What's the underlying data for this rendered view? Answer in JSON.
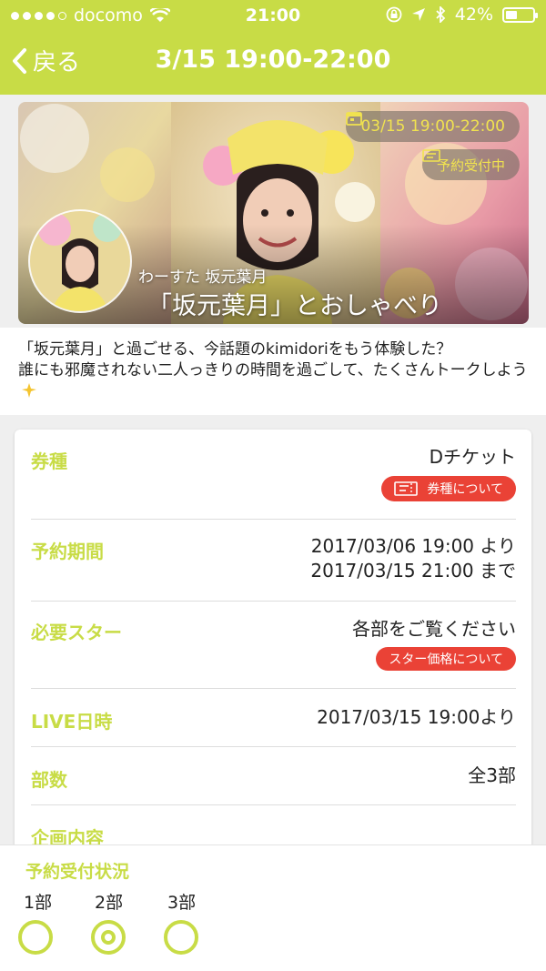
{
  "status_bar": {
    "carrier": "docomo",
    "time": "21:00",
    "battery": "42%",
    "battery_level": 0.42
  },
  "nav": {
    "back_label": "戻る",
    "title": "3/15 19:00-22:00"
  },
  "banner": {
    "date_pill": "03/15 19:00-22:00",
    "status_pill": "予約受付中",
    "subtitle": "わーすた 坂元葉月",
    "title": "「坂元葉月」とおしゃべり"
  },
  "description": {
    "line1": "「坂元葉月」と過ごせる、今話題のkimidoriをもう体験した？",
    "line2": "誰にも邪魔されない二人っきりの時間を過ごして、たくさんトークしよう"
  },
  "details": {
    "ticket_type": {
      "label": "券種",
      "value": "Dチケット",
      "badge": "券種について"
    },
    "reservation_period": {
      "label": "予約期間",
      "line1": "2017/03/06 19:00 より",
      "line2": "2017/03/15 21:00 まで"
    },
    "stars": {
      "label": "必要スター",
      "value": "各部をご覧ください",
      "badge": "スター価格について"
    },
    "live_date": {
      "label": "LIVE日時",
      "value": "2017/03/15 19:00より"
    },
    "parts": {
      "label": "部数",
      "value": "全3部"
    },
    "plan": {
      "label": "企画内容"
    }
  },
  "reservation_status": {
    "title": "予約受付状況",
    "parts": [
      {
        "label": "1部",
        "state": "available"
      },
      {
        "label": "2部",
        "state": "few-left"
      },
      {
        "label": "3部",
        "state": "available"
      }
    ]
  },
  "colors": {
    "accent": "#c8dc46",
    "badge_red": "#ea4236"
  }
}
